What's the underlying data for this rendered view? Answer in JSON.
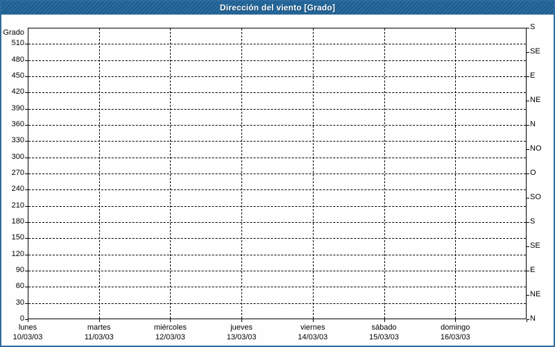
{
  "window": {
    "title": "Dirección del viento [Grado]"
  },
  "colors": {
    "titlebar_bg": "#1d6297",
    "titlebar_text": "#ffffff",
    "frame_border": "#2e6ba1",
    "plot_background": "#fdfefd",
    "grid_color": "#000000",
    "label_color": "#000000"
  },
  "chart_data": {
    "type": "line",
    "title": "Dirección del viento [Grado]",
    "grid": true,
    "legend": false,
    "series": [],
    "y_axis_left": {
      "label": "Grado",
      "min": 0,
      "max": 540,
      "tick_step": 30,
      "tick_labels": [
        "0",
        "30",
        "60",
        "90",
        "120",
        "150",
        "180",
        "210",
        "240",
        "270",
        "300",
        "330",
        "360",
        "390",
        "420",
        "450",
        "480",
        "510"
      ]
    },
    "y_axis_right": {
      "tick_step_degrees": 45,
      "labels_top_to_bottom": [
        "S",
        "SE",
        "E",
        "NE",
        "N",
        "NO",
        "O",
        "SO",
        "S",
        "SE",
        "E",
        "NE",
        "N"
      ]
    },
    "x_axis": {
      "days": [
        {
          "name": "lunes",
          "date": "10/03/03"
        },
        {
          "name": "martes",
          "date": "11/03/03"
        },
        {
          "name": "miércoles",
          "date": "12/03/03"
        },
        {
          "name": "jueves",
          "date": "13/03/03"
        },
        {
          "name": "viernes",
          "date": "14/03/03"
        },
        {
          "name": "sábado",
          "date": "15/03/03"
        },
        {
          "name": "domingo",
          "date": "16/03/03"
        }
      ]
    }
  }
}
